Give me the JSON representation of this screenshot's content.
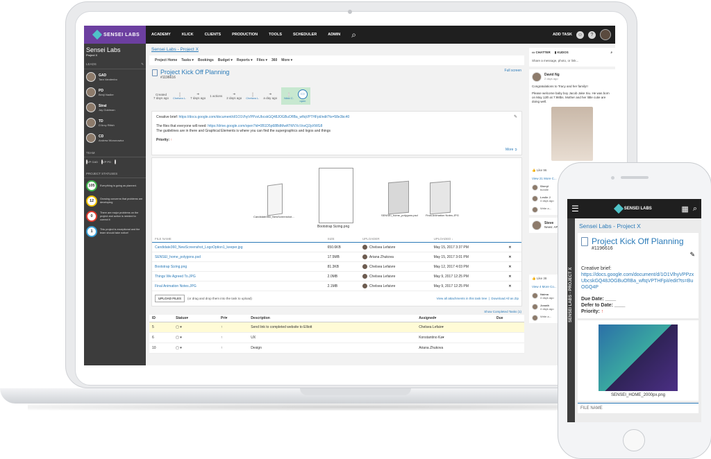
{
  "nav": {
    "brand": "SENSEI LABS",
    "items": [
      "ACADEMY",
      "KLICK",
      "CLIENTS",
      "PRODUCTION",
      "TOOLS",
      "SCHEDULER",
      "ADMIN"
    ],
    "add_task": "ADD TASK"
  },
  "sidebar": {
    "title": "Sensei Labs",
    "subtitle": "Project X",
    "leads_label": "LEADS",
    "leads": [
      {
        "code": "GAD",
        "name": "Tara Vandenbo"
      },
      {
        "code": "PD",
        "name": "Benji Nadler"
      },
      {
        "code": "Strat",
        "name": "Jay Goldman"
      },
      {
        "code": "TD",
        "name": "D'Arcy Ritish"
      },
      {
        "code": "CD",
        "name": "Andrew Woronowicz"
      }
    ],
    "team_label": "TEAM",
    "team": [
      "VP GAD",
      "VP PD",
      ""
    ],
    "statuses_label": "PROJECT STATUSES",
    "statuses": [
      {
        "count": "105",
        "color": "#3cb34a",
        "text": "Everything is going as planned."
      },
      {
        "count": "12",
        "color": "#f2c200",
        "text": "Growing concerns that problems are developing"
      },
      {
        "count": "0",
        "color": "#e03a2f",
        "text": "There are major problems on the project and action is needed to correct it"
      },
      {
        "count": "1",
        "color": "#3aa0d8",
        "text": "This project is exceptional and the team should take notice!"
      }
    ]
  },
  "main": {
    "breadcrumb": "Sensei Labs - Project X",
    "subnav": [
      "Project Home",
      "Tasks ▾",
      "Bookings",
      "Budget ▾",
      "Reports ▾",
      "Files ▾",
      "360",
      "More ▾"
    ],
    "title": "Project Kick Off Planning",
    "id": "#1196616",
    "fullscreen": "Full screen",
    "timeline": {
      "created_label": "Created",
      "created_ago": "7 days ago",
      "av1_name": "Chelsea L.",
      "step1": "7 days ago",
      "actions": "1 actions",
      "step2": "2 days ago",
      "av2_name": "Chelsea L.",
      "step3": "a day ago",
      "av3_name": "Nikki C.",
      "open_label": "open"
    },
    "brief_label": "Creative brief:",
    "brief_link": "https://docs.google.com/document/d/1O1VhyVPPzxUbcskGQ48JOGBuOfIBa_wftqVPTHFpiI/edit?ts=58e3bc40",
    "files_label": "The files that everyone will need:",
    "files_link": "https://drive.google.com/open?id=0B1D5p68BdMwATWVXcVoxQ2pXWG8",
    "guidelines": "The guidelines are in there and Graphical Elements is where you can find the supergraphics and logos and things",
    "priority_label": "Priority:",
    "more": "More",
    "thumb_captions": [
      "Candidate360_NewScreenshot...",
      "Bootstrap Sizing.png",
      "SENSEI_home_polygons.psd",
      "Final Animation Notes.JPG"
    ],
    "files_table": {
      "headers": [
        "FILE NAME",
        "SIZE",
        "UPLOADER",
        "UPLOADED ↓"
      ],
      "rows": [
        [
          "Candidate360_NewScreenshot_LogoOption1_keeper.jpg",
          "650.6KB",
          "Chelsea Lefaivre",
          "May 15, 2017 3:37 PM"
        ],
        [
          "SENSEI_home_polygons.psd",
          "17.5MB",
          "Ariana Zhukova",
          "May 15, 2017 3:01 PM"
        ],
        [
          "Bootstrap Sizing.png",
          "81.3KB",
          "Chelsea Lefaivre",
          "May 12, 2017 4:03 PM"
        ],
        [
          "Things We Agreed To.JPG",
          "2.0MB",
          "Chelsea Lefaivre",
          "May 9, 2017 12:25 PM"
        ],
        [
          "Final Animation Notes.JPG",
          "2.1MB",
          "Chelsea Lefaivre",
          "May 9, 2017 12:25 PM"
        ]
      ]
    },
    "upload_btn": "UPLOAD FILES",
    "upload_hint": "(or drag and drop them into the task to upload)",
    "view_all": "View all attachments in this task tree",
    "download_all": "Download All as Zip",
    "show_completed": "Show Completed Tasks (1)",
    "task_table": {
      "headers": [
        "ID",
        "Status▾",
        "Pri▾",
        "Description",
        "Assigned▾",
        "Due"
      ],
      "rows": [
        [
          "5",
          "▢ ▾",
          "↑",
          "Send link to completed website to Elliott",
          "Chelsea Lefaiv▾",
          ""
        ],
        [
          "6",
          "▢ ▾",
          "↑",
          "UX",
          "Konstantino Ka▾",
          ""
        ],
        [
          "10",
          "▢ ▾",
          "↑",
          "Design",
          "Ariana Zhukova",
          ""
        ]
      ]
    }
  },
  "chatter": {
    "tab1": "CHATTER",
    "tab2": "KUDOS",
    "share": "Share a message, photo, or link...",
    "post_name": "David Ng",
    "post_date": "2 days ago",
    "post_line1": "Congratulations to Tracy and her family!!",
    "post_line2": "Please welcome baby boy Jacob Jake Siu. He was born on May 12th at 7:98lbs. Mother and her little cutie are doing well.",
    "likes1": "Like 96",
    "view_more1": "View 21 More C...",
    "commenters": [
      {
        "name": "Sheryl",
        "text": "bundle"
      },
      {
        "name": "Leslie J",
        "text": "4 days ago"
      },
      {
        "name": "",
        "text": "Write a..."
      }
    ],
    "post2_name": "Steve",
    "post2_text": "News: API Whit...",
    "likes2": "Like 38",
    "view_more2": "View 4 More Co...",
    "commenters2": [
      {
        "name": "Naima",
        "text": "4 days ago"
      },
      {
        "name": "Jonath",
        "text": "4 days ago"
      },
      {
        "name": "",
        "text": "Write a..."
      }
    ]
  },
  "phone": {
    "brand": "SENSEI LABS",
    "side_text": "SENSEI LABS - PROJECT X",
    "breadcrumb": "Sensei Labs - Project X",
    "title": "Project Kick Off Planning",
    "id": "#1196616",
    "brief_label": "Creative brief:",
    "brief_link": "https://docs.google.com/document/d/1O1VlhyVPPzxUbcskGQ48JOGBuOfIBa_wftqVPTHFpiI/edit?ts=BuOGQ4P",
    "due": "Due Date: ____",
    "defer": "Defer to Date: ____",
    "priority": "Priority:",
    "img_caption": "SENSEI_HOME_2000px.png",
    "file_header": "FILE NAME"
  }
}
